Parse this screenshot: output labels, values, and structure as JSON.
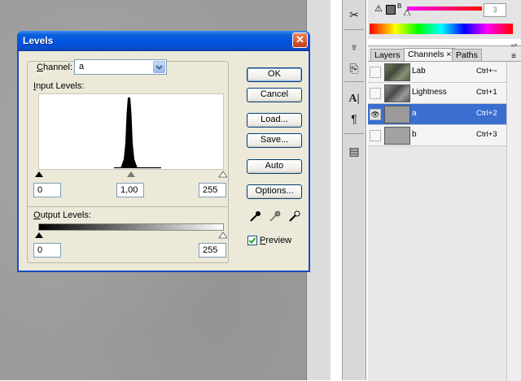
{
  "dialog": {
    "title": "Levels",
    "close_glyph": "✕",
    "channel_label": "Channel:",
    "channel_value": "a",
    "input_levels_label": "Input Levels:",
    "input_black": "0",
    "input_gamma": "1,00",
    "input_white": "255",
    "output_levels_label": "Output Levels:",
    "output_black": "0",
    "output_white": "255",
    "buttons": {
      "ok": "OK",
      "cancel": "Cancel",
      "load": "Load...",
      "save": "Save...",
      "auto": "Auto",
      "options": "Options..."
    },
    "preview_label": "Preview",
    "preview_checked": true
  },
  "panel": {
    "tabs": [
      "Layers",
      "Channels",
      "Paths"
    ],
    "active_tab": "Channels",
    "tab_close": "×",
    "brightness_value": "3",
    "brightness_label": "B",
    "channels": [
      {
        "name": "Lab",
        "shortcut": "Ctrl+~",
        "visible": false,
        "selected": false
      },
      {
        "name": "Lightness",
        "shortcut": "Ctrl+1",
        "visible": false,
        "selected": false
      },
      {
        "name": "a",
        "shortcut": "Ctrl+2",
        "visible": true,
        "selected": true
      },
      {
        "name": "b",
        "shortcut": "Ctrl+3",
        "visible": false,
        "selected": false
      }
    ]
  },
  "colors": {
    "title_bar": "#0054e3",
    "selection": "#3a6fd0",
    "dialog_bg": "#ece9d8"
  }
}
